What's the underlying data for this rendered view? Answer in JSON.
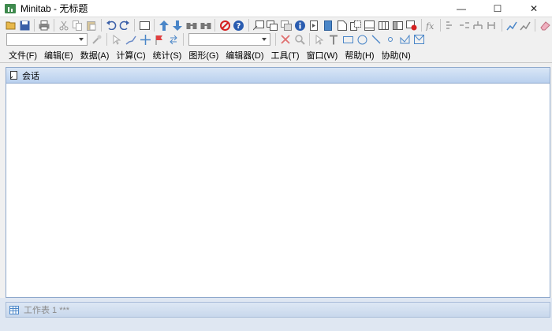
{
  "window": {
    "title": "Minitab - 无标题",
    "minimize": "—",
    "maximize": "☐",
    "close": "✕"
  },
  "toolbar1": {
    "icons": [
      "open-icon",
      "save-icon",
      "print-icon",
      "cut-icon",
      "copy-icon",
      "paste-icon",
      "undo-icon",
      "redo-icon",
      "blank-window-icon",
      "arrow-up-icon",
      "arrow-down-icon",
      "find-icon",
      "find-replace-icon",
      "cancel-icon",
      "help-icon",
      "session-window-icon",
      "worksheet-icon",
      "graph-icon",
      "info-icon",
      "history-icon",
      "report-icon",
      "new-doc-icon",
      "duplicate-icon",
      "layout-icon",
      "table-icon",
      "panel-icon",
      "close-all-icon",
      "formula-icon",
      "tree-icon",
      "tree2-icon",
      "tree3-icon",
      "tree4-icon",
      "chart-edit-icon",
      "chart-add-icon",
      "eraser-icon"
    ]
  },
  "toolbar2": {
    "combo1_value": "",
    "combo2_value": ""
  },
  "menu": [
    "文件(F)",
    "编辑(E)",
    "数据(A)",
    "计算(C)",
    "统计(S)",
    "图形(G)",
    "编辑器(D)",
    "工具(T)",
    "窗口(W)",
    "帮助(H)",
    "协助(N)"
  ],
  "session": {
    "title": "会话"
  },
  "worksheet": {
    "label": "工作表 1 ***"
  },
  "colors": {
    "header_blue": "#b9d0ee",
    "border_blue": "#8ea8cc"
  }
}
